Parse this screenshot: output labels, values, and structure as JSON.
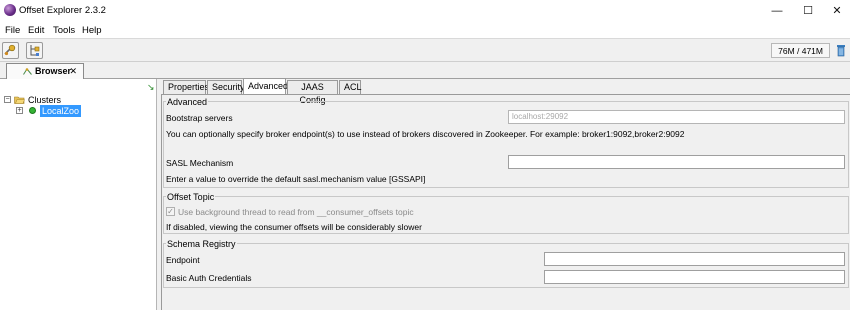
{
  "window": {
    "title": "Offset Explorer  2.3.2",
    "minimize": "—",
    "maximize": "☐",
    "close": "✕"
  },
  "menu": {
    "file": "File",
    "edit": "Edit",
    "tools": "Tools",
    "help": "Help"
  },
  "toolbar": {
    "memory": "76M / 471M"
  },
  "browser_tab": {
    "label": "Browser",
    "close": "✕"
  },
  "tree": {
    "clusters_label": "Clusters",
    "clusters_toggle": "−",
    "zoo_toggle": "+",
    "zoo_label": "LocalZoo"
  },
  "tabs": [
    {
      "label": "Properties"
    },
    {
      "label": "Security"
    },
    {
      "label": "Advanced"
    },
    {
      "label": "JAAS Config"
    },
    {
      "label": "ACL"
    }
  ],
  "advanced": {
    "title": "Advanced",
    "bootstrap_label": "Bootstrap servers",
    "bootstrap_placeholder": "localhost:29092",
    "bootstrap_help": "You can optionally specify broker endpoint(s) to use instead of brokers discovered in Zookeeper. For example: broker1:9092,broker2:9092",
    "sasl_label": "SASL Mechanism",
    "sasl_value": "",
    "sasl_help": "Enter a value to override the default sasl.mechanism value [GSSAPI]"
  },
  "offset_topic": {
    "title": "Offset Topic",
    "checkbox_checked": true,
    "checkbox_mark": "✓",
    "checkbox_label": "Use background thread to read from __consumer_offsets topic",
    "help": "If disabled, viewing the consumer offsets will be considerably slower"
  },
  "schema_registry": {
    "title": "Schema Registry",
    "endpoint_label": "Endpoint",
    "endpoint_value": "",
    "auth_label": "Basic Auth Credentials",
    "auth_value": ""
  }
}
